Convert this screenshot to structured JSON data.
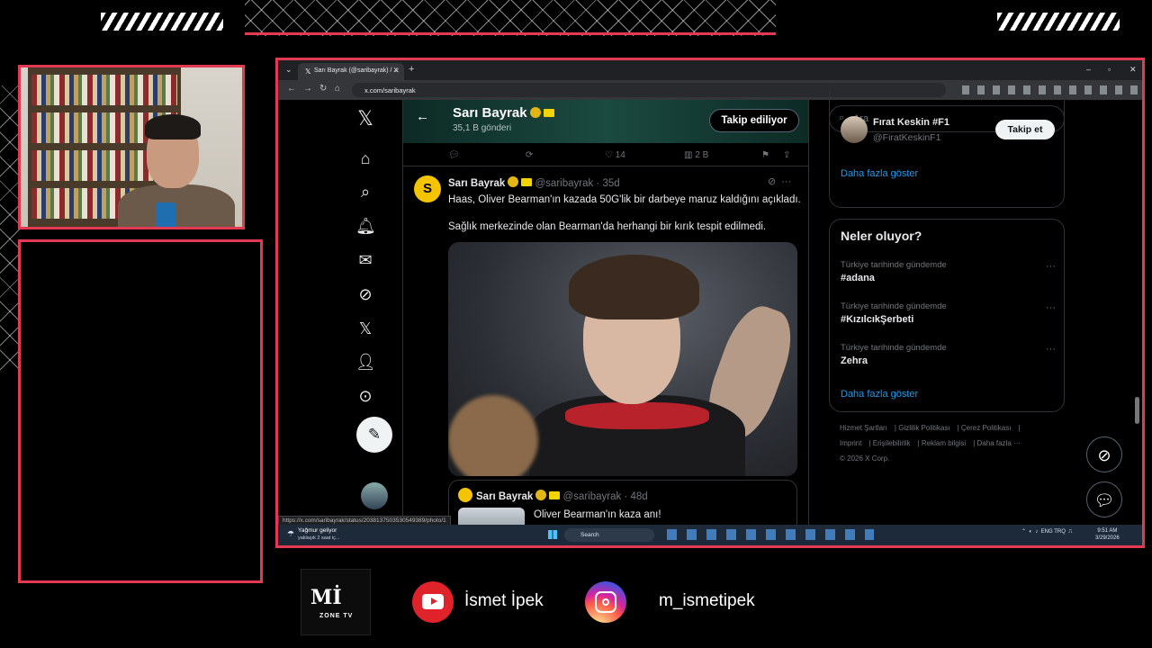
{
  "browser": {
    "tab_title": "Sarı Bayrak (@saribayrak) / X",
    "url": "x.com/saribayrak",
    "status_url": "https://x.com/saribayrak/status/2038137503530549389/photo/1"
  },
  "profile_header": {
    "name": "Sarı Bayrak",
    "post_count": "35,1 B gönderi",
    "follow_label": "Takip ediliyor"
  },
  "prev_actions": {
    "likes": "14",
    "views": "2 B"
  },
  "tweet": {
    "name": "Sarı Bayrak",
    "handle_time": "@saribayrak · 35d",
    "text_1": "Haas, Oliver Bearman'ın kazada 50G'lik bir darbeye maruz kaldığını açıkladı.",
    "text_2": "Sağlık merkezinde olan Bearman'da herhangi bir kırık tespit edilmedi.",
    "quote": {
      "name": "Sarı Bayrak",
      "handle_time": "@saribayrak · 48d",
      "text": "Oliver Bearman'ın kaza anı!"
    }
  },
  "sidebar": {
    "search_placeholder": "Ara",
    "who_to_follow": {
      "name": "Fırat Keskin #F1",
      "handle": "@FiratKeskinF1",
      "follow_label": "Takip et",
      "more_label": "Daha fazla göster"
    },
    "trends": {
      "title": "Neler oluyor?",
      "items": [
        {
          "meta": "Türkiye tarihinde gündemde",
          "name": "#adana"
        },
        {
          "meta": "Türkiye tarihinde gündemde",
          "name": "#KızılcıkŞerbeti"
        },
        {
          "meta": "Türkiye tarihinde gündemde",
          "name": "Zehra"
        }
      ],
      "more_label": "Daha fazla göster"
    },
    "footer": {
      "links": [
        "Hizmet Şartları",
        "Gizlilik Politikası",
        "Çerez Politikası",
        "Imprint",
        "Erişilebilirlik",
        "Reklam bilgisi",
        "Daha fazla ···"
      ],
      "copyright": "© 2026 X Corp."
    }
  },
  "taskbar": {
    "weather_title": "Yağmur geliyor",
    "weather_sub": "yaklaşık 2 saat iç...",
    "search_label": "Search",
    "lang": "ENG\nTRQ",
    "time": "9:51 AM",
    "date": "3/29/2026"
  },
  "branding": {
    "logo_main": "Mİ",
    "logo_sub": "ZONE TV",
    "youtube_name": "İsmet İpek",
    "instagram_name": "m_ismetipek"
  },
  "colors": {
    "accent_frame": "#e23a52",
    "link_blue": "#1d9bf0",
    "x_bg": "#000000"
  },
  "icons": [
    "x-logo-icon",
    "home-icon",
    "search-icon",
    "bell-icon",
    "mail-icon",
    "grok-icon",
    "premium-x-icon",
    "profile-icon",
    "more-circle-icon",
    "post-feather-icon",
    "reply-icon",
    "repost-icon",
    "like-icon",
    "views-icon",
    "bookmark-icon",
    "share-icon",
    "youtube-icon",
    "instagram-icon"
  ]
}
